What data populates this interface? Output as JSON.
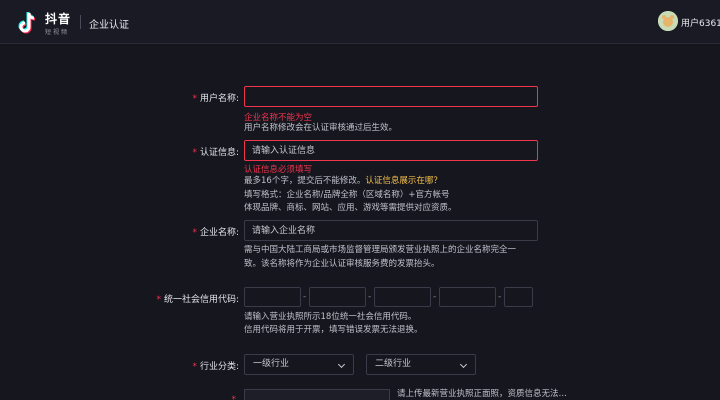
{
  "header": {
    "brand_name": "抖音",
    "brand_sub": "短视频",
    "page_title": "企业认证",
    "username": "用户6361…",
    "brand_colors": {
      "cyan": "#25f4ee",
      "red": "#fe2c55"
    }
  },
  "form": {
    "username": {
      "label": "用户名称:",
      "value": "",
      "error": "企业名称不能为空",
      "help": "用户名称修改会在认证审核通过后生效。"
    },
    "cert_info": {
      "label": "认证信息:",
      "placeholder": "请输入认证信息",
      "error": "认证信息必须填写",
      "help_line1": "最多16个字，提交后不能修改。",
      "help_link": "认证信息展示在哪？",
      "help_line2": "填写格式：企业名称/品牌全称（区域名称）+官方帐号",
      "help_line3": "体现品牌、商标、网站、应用、游戏等需提供对应资质。"
    },
    "company_name": {
      "label": "企业名称:",
      "placeholder": "请输入企业名称",
      "help_line1": "需与中国大陆工商局或市场监督管理局颁发营业执照上的企业名称完全一",
      "help_line2": "致。该名称将作为企业认证审核服务费的发票抬头。"
    },
    "credit_code": {
      "label": "统一社会信用代码:",
      "segment_values": [
        "",
        "",
        "",
        "",
        "",
        ""
      ],
      "separator": "-",
      "help_line1": "请输入营业执照所示18位统一社会信用代码。",
      "help_line2": "信用代码将用于开票，填写错误发票无法退换。"
    },
    "industry": {
      "label": "行业分类:",
      "level1": "一级行业",
      "level2": "二级行业"
    },
    "license": {
      "help": "请上传最新营业执照正面照，资质信息无法…"
    }
  },
  "colors": {
    "error": "#f0344c",
    "link": "#f5c14a",
    "background": "#16161f"
  }
}
